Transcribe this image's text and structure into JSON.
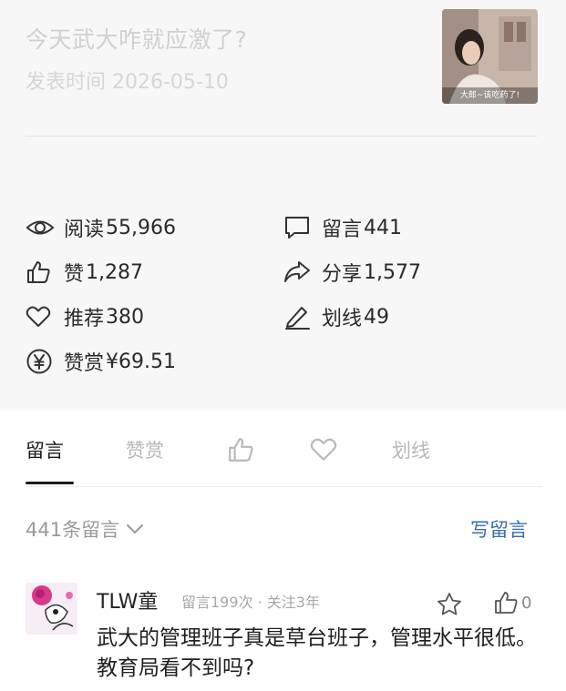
{
  "article": {
    "title": "今天武大咋就应激了?",
    "date": "发表时间 2026-05-10",
    "thumbnail_caption": "大郎~该吃药了!"
  },
  "stats": {
    "reads": {
      "label": "阅读",
      "value": "55,966",
      "icon": "eye-icon"
    },
    "comments": {
      "label": "留言",
      "value": "441",
      "icon": "comment-icon"
    },
    "likes": {
      "label": "赞",
      "value": "1,287",
      "icon": "thumbs-up-icon"
    },
    "shares": {
      "label": "分享",
      "value": "1,577",
      "icon": "share-icon"
    },
    "recommends": {
      "label": "推荐",
      "value": "380",
      "icon": "heart-icon"
    },
    "highlights": {
      "label": "划线",
      "value": "49",
      "icon": "pen-icon"
    },
    "rewards": {
      "label": "赞赏",
      "value": "¥69.51",
      "icon": "yen-circle-icon"
    }
  },
  "tabs": {
    "comments": "留言",
    "rewards": "赞赏",
    "highlights": "划线"
  },
  "comment_header": {
    "count_label": "441条留言",
    "write_label": "写留言"
  },
  "comments": [
    {
      "name": "TLW童",
      "meta": "留言199次 · 关注3年",
      "likes": "0",
      "text": "武大的管理班子真是草台班子，管理水平很低。教育局看不到吗?"
    }
  ],
  "colors": {
    "card_bg": "#f7f7f7",
    "link_blue": "#3a6ea5",
    "tab_active": "#1c1c1c",
    "tab_inactive": "#b8b8b8"
  }
}
